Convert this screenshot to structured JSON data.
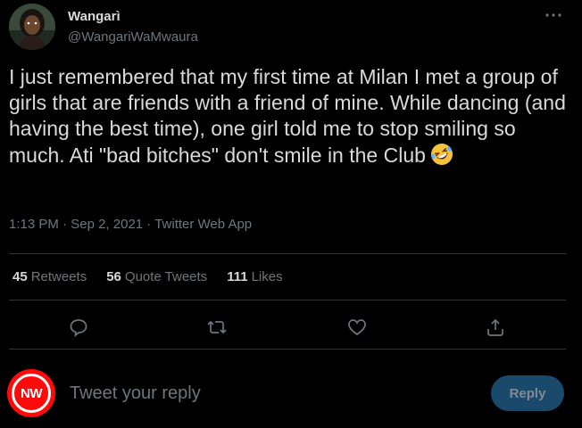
{
  "tweet": {
    "author_name": "Wangarì",
    "author_handle": "@WangariWaMwaura",
    "more_icon": "ellipsis-icon",
    "text": "I just remembered that my first time at Milan I met a group of girls that are friends with a friend of mine. While dancing (and having the best time), one girl told me to stop smiling so much. Ati \"bad bitches\" don't smile in the Club",
    "emoji": "rolling-on-floor-laughing-emoji",
    "time": "1:13 PM",
    "date": "Sep 2, 2021",
    "source": "Twitter Web App",
    "separator": "·"
  },
  "stats": {
    "retweets_count": "45",
    "retweets_label": "Retweets",
    "quote_tweets_count": "56",
    "quote_tweets_label": "Quote Tweets",
    "likes_count": "111",
    "likes_label": "Likes"
  },
  "actions": [
    "reply-icon",
    "retweet-icon",
    "like-icon",
    "share-icon"
  ],
  "reply_bar": {
    "avatar_text": "NW",
    "placeholder": "Tweet your reply",
    "button_label": "Reply"
  },
  "colors": {
    "background": "#000000",
    "text": "#d9d9d9",
    "muted": "#6e767d",
    "divider": "#2f3336",
    "reply_button": "#1a4a6b",
    "avatar_red": "#ff0a0a"
  }
}
